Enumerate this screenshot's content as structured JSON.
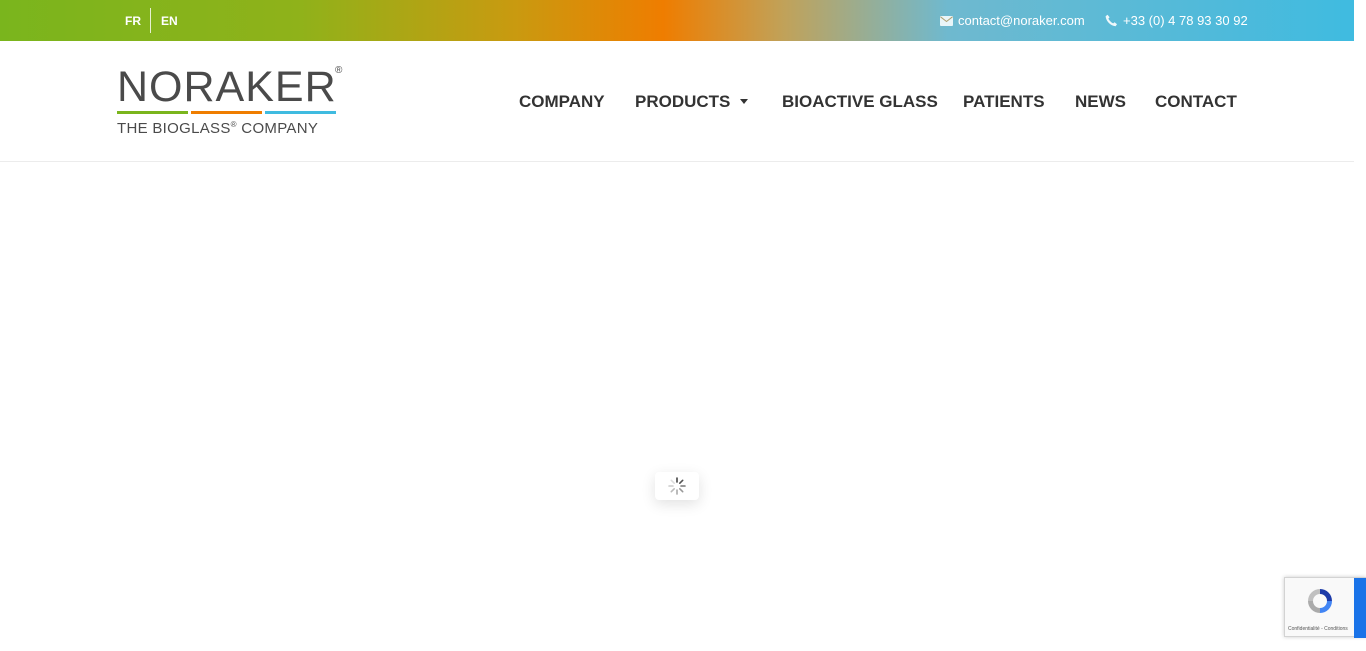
{
  "topbar": {
    "languages": [
      "FR",
      "EN"
    ],
    "email": "contact@noraker.com",
    "phone": "+33 (0) 4 78 93 30 92"
  },
  "logo": {
    "name": "NORAKER",
    "registered": "®",
    "tagline_prefix": "THE BIOGLASS",
    "tagline_reg": "®",
    "tagline_suffix": " COMPANY",
    "bar_colors": [
      "#7ab51d",
      "#ef7d00",
      "#3fbbe0"
    ]
  },
  "nav": {
    "items": [
      "COMPANY",
      "PRODUCTS",
      "BIOACTIVE GLASS",
      "PATIENTS",
      "NEWS",
      "CONTACT"
    ]
  },
  "recaptcha": {
    "legal": "Confidentialité - Conditions"
  },
  "colors": {
    "nav_text": "#333333",
    "topbar_green": "#7ab51d",
    "topbar_orange": "#ef7d00",
    "topbar_blue": "#3fbbe0"
  }
}
